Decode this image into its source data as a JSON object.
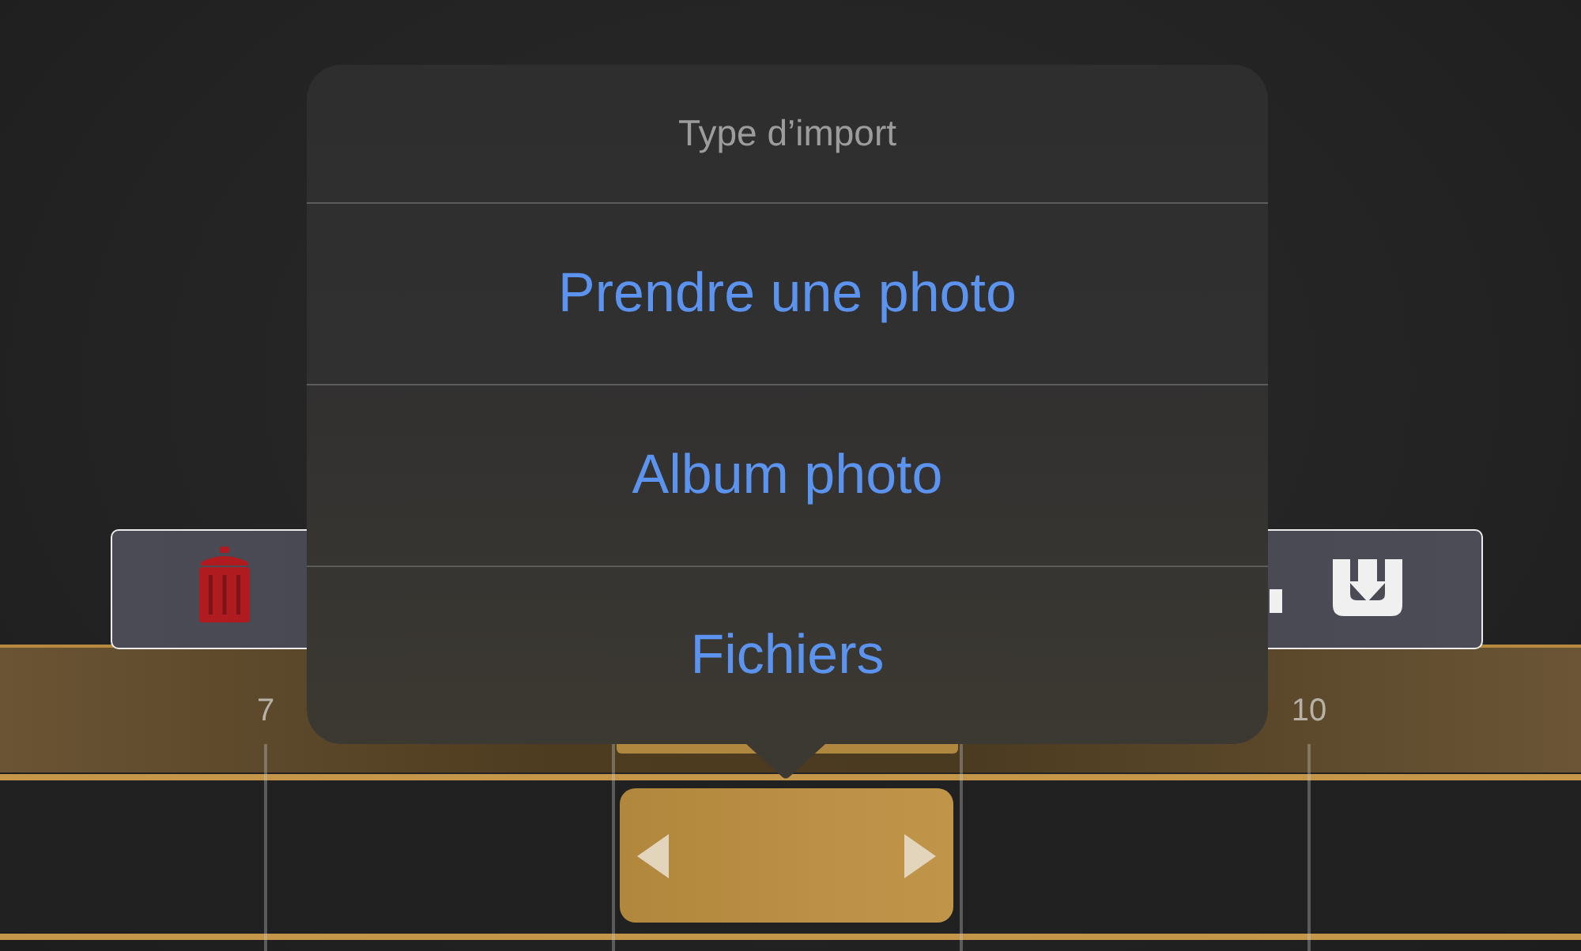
{
  "popover": {
    "title": "Type d’import",
    "options": [
      "Prendre une photo",
      "Album photo",
      "Fichiers"
    ]
  },
  "ruler": {
    "labels": [
      "7",
      "10"
    ]
  }
}
